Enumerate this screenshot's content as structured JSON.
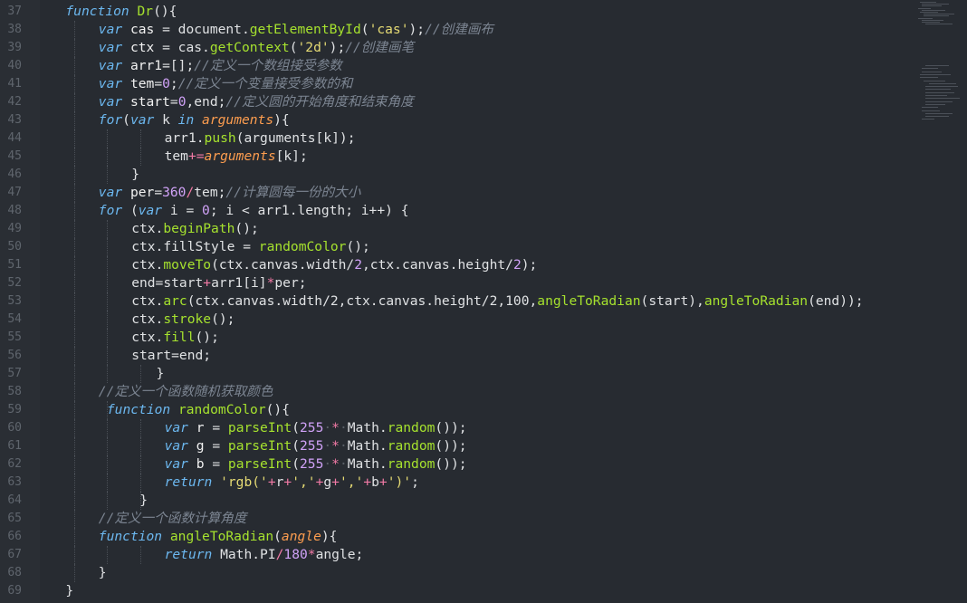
{
  "editor": {
    "first_line": 37,
    "lines": [
      {
        "n": "37",
        "indent": 4,
        "tokens": [
          [
            "kw",
            "function"
          ],
          [
            "pl",
            " "
          ],
          [
            "fn",
            "Dr"
          ],
          [
            "pl",
            "(){"
          ]
        ]
      },
      {
        "n": "38",
        "indent": 8,
        "tokens": [
          [
            "kw",
            "var"
          ],
          [
            "pl",
            " "
          ],
          [
            "idt",
            "cas"
          ],
          [
            "pl",
            " = "
          ],
          [
            "pl",
            "document."
          ],
          [
            "fn",
            "getElementById"
          ],
          [
            "pl",
            "("
          ],
          [
            "str",
            "'cas'"
          ],
          [
            "pl",
            ");"
          ],
          [
            "cm",
            "//创建画布"
          ]
        ]
      },
      {
        "n": "39",
        "indent": 8,
        "tokens": [
          [
            "kw",
            "var"
          ],
          [
            "pl",
            " "
          ],
          [
            "idt",
            "ctx"
          ],
          [
            "pl",
            " = "
          ],
          [
            "pl",
            "cas."
          ],
          [
            "fn",
            "getContext"
          ],
          [
            "pl",
            "("
          ],
          [
            "str",
            "'2d'"
          ],
          [
            "pl",
            ");"
          ],
          [
            "cm",
            "//创建画笔"
          ]
        ]
      },
      {
        "n": "40",
        "indent": 8,
        "tokens": [
          [
            "kw",
            "var"
          ],
          [
            "pl",
            " "
          ],
          [
            "idt",
            "arr1"
          ],
          [
            "pl",
            "=[];"
          ],
          [
            "cm",
            "//定义一个数组接受参数"
          ]
        ]
      },
      {
        "n": "41",
        "indent": 8,
        "tokens": [
          [
            "kw",
            "var"
          ],
          [
            "pl",
            " "
          ],
          [
            "idt",
            "tem"
          ],
          [
            "pl",
            "="
          ],
          [
            "num",
            "0"
          ],
          [
            "pl",
            ";"
          ],
          [
            "cm",
            "//定义一个变量接受参数的和"
          ]
        ]
      },
      {
        "n": "42",
        "indent": 8,
        "tokens": [
          [
            "kw",
            "var"
          ],
          [
            "pl",
            " "
          ],
          [
            "idt",
            "start"
          ],
          [
            "pl",
            "="
          ],
          [
            "num",
            "0"
          ],
          [
            "pl",
            ",end;"
          ],
          [
            "cm",
            "//定义圆的开始角度和结束角度"
          ]
        ]
      },
      {
        "n": "43",
        "indent": 8,
        "tokens": [
          [
            "kw",
            "for"
          ],
          [
            "pl",
            "("
          ],
          [
            "kw",
            "var"
          ],
          [
            "pl",
            " k "
          ],
          [
            "kw",
            "in"
          ],
          [
            "pl",
            " "
          ],
          [
            "it",
            "arguments"
          ],
          [
            "pl",
            "){"
          ]
        ]
      },
      {
        "n": "44",
        "indent": 16,
        "tokens": [
          [
            "pl",
            "arr1."
          ],
          [
            "fn",
            "push"
          ],
          [
            "pl",
            "(arguments[k]);"
          ]
        ]
      },
      {
        "n": "45",
        "indent": 16,
        "tokens": [
          [
            "pl",
            "tem"
          ],
          [
            "op",
            "+="
          ],
          [
            "it",
            "arguments"
          ],
          [
            "pl",
            "[k];"
          ]
        ]
      },
      {
        "n": "46",
        "indent": 12,
        "tokens": [
          [
            "pl",
            "}"
          ]
        ]
      },
      {
        "n": "47",
        "indent": 8,
        "tokens": [
          [
            "kw",
            "var"
          ],
          [
            "pl",
            " "
          ],
          [
            "idt",
            "per"
          ],
          [
            "pl",
            "="
          ],
          [
            "num",
            "360"
          ],
          [
            "op",
            "/"
          ],
          [
            "pl",
            "tem;"
          ],
          [
            "cm",
            "//计算圆每一份的大小"
          ]
        ]
      },
      {
        "n": "48",
        "indent": 8,
        "tokens": [
          [
            "kw",
            "for"
          ],
          [
            "pl",
            " ("
          ],
          [
            "kw",
            "var"
          ],
          [
            "pl",
            " i = "
          ],
          [
            "num",
            "0"
          ],
          [
            "pl",
            "; i < arr1.length; i++) {"
          ]
        ]
      },
      {
        "n": "49",
        "indent": 12,
        "tokens": [
          [
            "pl",
            "ctx."
          ],
          [
            "fn",
            "beginPath"
          ],
          [
            "pl",
            "();"
          ]
        ]
      },
      {
        "n": "50",
        "indent": 12,
        "tokens": [
          [
            "pl",
            "ctx."
          ],
          [
            "pl",
            "fillStyle = "
          ],
          [
            "fn",
            "randomColor"
          ],
          [
            "pl",
            "();"
          ]
        ]
      },
      {
        "n": "51",
        "indent": 12,
        "tokens": [
          [
            "pl",
            "ctx."
          ],
          [
            "fn",
            "moveTo"
          ],
          [
            "pl",
            "(ctx.canvas.width/"
          ],
          [
            "num",
            "2"
          ],
          [
            "pl",
            ",ctx.canvas.height/"
          ],
          [
            "num",
            "2"
          ],
          [
            "pl",
            ");"
          ]
        ]
      },
      {
        "n": "52",
        "indent": 12,
        "tokens": [
          [
            "pl",
            "end=start"
          ],
          [
            "op",
            "+"
          ],
          [
            "pl",
            "arr1[i]"
          ],
          [
            "op",
            "*"
          ],
          [
            "pl",
            "per;"
          ]
        ]
      },
      {
        "n": "53",
        "indent": 12,
        "tokens": [
          [
            "pl",
            "ctx."
          ],
          [
            "fn",
            "arc"
          ],
          [
            "pl",
            "(ctx.canvas.width/2,ctx.canvas.height/2,100,"
          ],
          [
            "fn",
            "angleToRadian"
          ],
          [
            "pl",
            "(start),"
          ],
          [
            "fn",
            "angleToRadian"
          ],
          [
            "pl",
            "(end));"
          ]
        ]
      },
      {
        "n": "54",
        "indent": 12,
        "tokens": [
          [
            "pl",
            "ctx."
          ],
          [
            "fn",
            "stroke"
          ],
          [
            "pl",
            "();"
          ]
        ]
      },
      {
        "n": "55",
        "indent": 12,
        "tokens": [
          [
            "pl",
            "ctx."
          ],
          [
            "fn",
            "fill"
          ],
          [
            "pl",
            "();"
          ]
        ]
      },
      {
        "n": "56",
        "indent": 12,
        "tokens": [
          [
            "pl",
            "start=end;"
          ]
        ]
      },
      {
        "n": "57",
        "indent": 15,
        "tokens": [
          [
            "pl",
            "}"
          ]
        ]
      },
      {
        "n": "58",
        "indent": 8,
        "tokens": [
          [
            "cm",
            "//定义一个函数随机获取颜色"
          ]
        ]
      },
      {
        "n": "59",
        "indent": 9,
        "tokens": [
          [
            "kw",
            "function"
          ],
          [
            "pl",
            " "
          ],
          [
            "fn",
            "randomColor"
          ],
          [
            "pl",
            "(){"
          ]
        ]
      },
      {
        "n": "60",
        "indent": 16,
        "tokens": [
          [
            "kw",
            "var"
          ],
          [
            "pl",
            " "
          ],
          [
            "idt",
            "r"
          ],
          [
            "pl",
            " = "
          ],
          [
            "fn",
            "parseInt"
          ],
          [
            "pl",
            "("
          ],
          [
            "num",
            "255"
          ],
          [
            "sp",
            "·"
          ],
          [
            "op",
            "*"
          ],
          [
            "sp",
            "·"
          ],
          [
            "pl",
            "Math."
          ],
          [
            "fn",
            "random"
          ],
          [
            "pl",
            "());"
          ]
        ]
      },
      {
        "n": "61",
        "indent": 16,
        "tokens": [
          [
            "kw",
            "var"
          ],
          [
            "pl",
            " "
          ],
          [
            "idt",
            "g"
          ],
          [
            "pl",
            " = "
          ],
          [
            "fn",
            "parseInt"
          ],
          [
            "pl",
            "("
          ],
          [
            "num",
            "255"
          ],
          [
            "sp",
            "·"
          ],
          [
            "op",
            "*"
          ],
          [
            "sp",
            "·"
          ],
          [
            "pl",
            "Math."
          ],
          [
            "fn",
            "random"
          ],
          [
            "pl",
            "());"
          ]
        ]
      },
      {
        "n": "62",
        "indent": 16,
        "tokens": [
          [
            "kw",
            "var"
          ],
          [
            "pl",
            " "
          ],
          [
            "idt",
            "b"
          ],
          [
            "pl",
            " = "
          ],
          [
            "fn",
            "parseInt"
          ],
          [
            "pl",
            "("
          ],
          [
            "num",
            "255"
          ],
          [
            "sp",
            "·"
          ],
          [
            "op",
            "*"
          ],
          [
            "sp",
            "·"
          ],
          [
            "pl",
            "Math."
          ],
          [
            "fn",
            "random"
          ],
          [
            "pl",
            "());"
          ]
        ]
      },
      {
        "n": "63",
        "indent": 16,
        "tokens": [
          [
            "kw",
            "return"
          ],
          [
            "pl",
            " "
          ],
          [
            "str",
            "'rgb('"
          ],
          [
            "op",
            "+"
          ],
          [
            "pl",
            "r"
          ],
          [
            "op",
            "+"
          ],
          [
            "str",
            "','"
          ],
          [
            "op",
            "+"
          ],
          [
            "pl",
            "g"
          ],
          [
            "op",
            "+"
          ],
          [
            "str",
            "','"
          ],
          [
            "op",
            "+"
          ],
          [
            "pl",
            "b"
          ],
          [
            "op",
            "+"
          ],
          [
            "str",
            "')'"
          ],
          [
            "pl",
            ";"
          ]
        ]
      },
      {
        "n": "64",
        "indent": 13,
        "tokens": [
          [
            "pl",
            "}"
          ]
        ]
      },
      {
        "n": "65",
        "indent": 8,
        "tokens": [
          [
            "cm",
            "//定义一个函数计算角度"
          ]
        ]
      },
      {
        "n": "66",
        "indent": 8,
        "tokens": [
          [
            "kw",
            "function"
          ],
          [
            "pl",
            " "
          ],
          [
            "fn",
            "angleToRadian"
          ],
          [
            "pl",
            "("
          ],
          [
            "pm",
            "angle"
          ],
          [
            "pl",
            "){"
          ]
        ]
      },
      {
        "n": "67",
        "indent": 16,
        "tokens": [
          [
            "kw",
            "return"
          ],
          [
            "pl",
            " Math.PI"
          ],
          [
            "op",
            "/"
          ],
          [
            "num",
            "180"
          ],
          [
            "op",
            "*"
          ],
          [
            "pl",
            "angle;"
          ]
        ]
      },
      {
        "n": "68",
        "indent": 8,
        "tokens": [
          [
            "pl",
            "}"
          ]
        ]
      },
      {
        "n": "69",
        "indent": 4,
        "tokens": [
          [
            "pl",
            "}"
          ]
        ]
      }
    ]
  },
  "colors": {
    "background": "#272b31",
    "keyword": "#6cb8f0",
    "function_name": "#a6e22e",
    "string": "#e6db74",
    "number": "#d0a2f7",
    "comment": "#7c8592",
    "operator": "#f27aa6"
  }
}
